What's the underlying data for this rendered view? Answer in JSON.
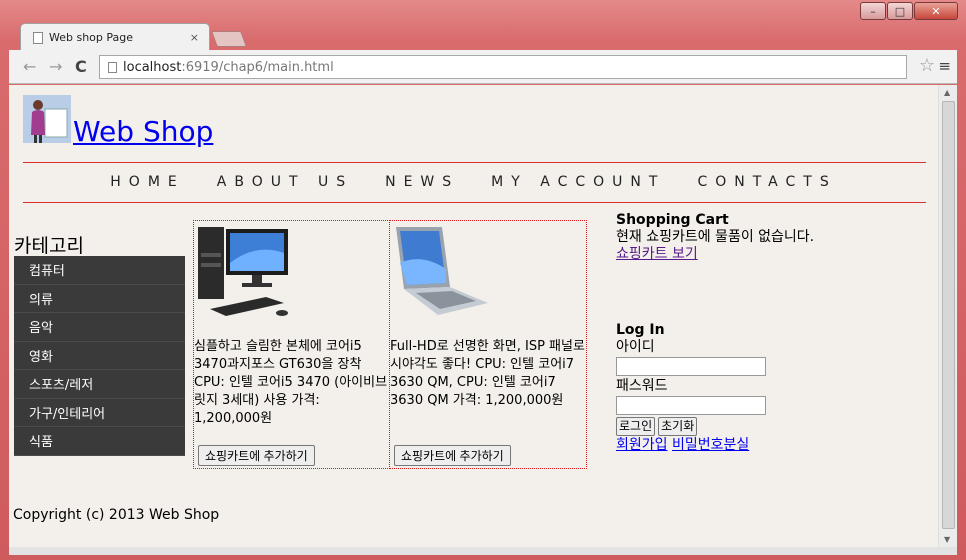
{
  "browser": {
    "tab_title": "Web shop Page",
    "tab_close": "×",
    "url_host": "localhost",
    "url_path": ":6919/chap6/main.html"
  },
  "header": {
    "site_title": "Web Shop"
  },
  "menu": [
    "HOME",
    "ABOUT US",
    "NEWS",
    "MY ACCOUNT",
    "CONTACTS"
  ],
  "category": {
    "title": "카테고리",
    "items": [
      "컴퓨터",
      "의류",
      "음악",
      "영화",
      "스포츠/레저",
      "가구/인테리어",
      "식품"
    ]
  },
  "products": [
    {
      "desc": "심플하고 슬림한 본체에 코어i5 3470과지포스 GT630을 장착 CPU: 인텔 코어i5 3470 (아이비브릿지 3세대) 사용 가격: 1,200,000원",
      "button": "쇼핑카트에 추가하기"
    },
    {
      "desc": "Full-HD로 선명한 화면, ISP 패널로 시야각도 좋다! CPU: 인텔 코어i7 3630 QM, CPU: 인텔 코어i7 3630 QM 가격: 1,200,000원",
      "button": "쇼핑카트에 추가하기"
    }
  ],
  "cart": {
    "title": "Shopping Cart",
    "text": "현재 쇼핑카트에 물품이 없습니다.",
    "link": "쇼핑카트 보기"
  },
  "login": {
    "title": "Log In",
    "id_label": "아이디",
    "pw_label": "패스워드",
    "login_btn": "로그인",
    "reset_btn": "초기화",
    "signup_link": "회원가입",
    "lost_pw_link": "비밀번호분실"
  },
  "footer": {
    "copyright": "Copyright (c) 2013 Web Shop"
  }
}
